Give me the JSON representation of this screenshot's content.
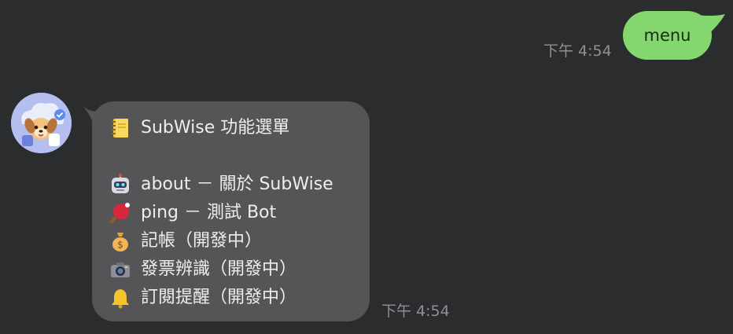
{
  "outgoing": {
    "text": "menu",
    "time": "下午 4:54"
  },
  "incoming": {
    "avatar_icon": "puppy-cloud-avatar",
    "time": "下午 4:54",
    "title": "SubWise 功能選單",
    "lines": [
      {
        "icon": "notebook-icon",
        "text": "SubWise 功能選單"
      },
      {
        "icon": "robot-icon",
        "text": "about － 關於 SubWise"
      },
      {
        "icon": "ping-pong-icon",
        "text": "ping － 測試 Bot"
      },
      {
        "icon": "money-bag-icon",
        "text": "記帳（開發中）"
      },
      {
        "icon": "camera-icon",
        "text": "發票辨識（開發中）"
      },
      {
        "icon": "bell-icon",
        "text": "訂閱提醒（開發中）"
      }
    ]
  },
  "colors": {
    "background": "#2b2c2e",
    "outgoing_bubble": "#84d66e",
    "incoming_bubble": "#555557",
    "timestamp": "#8e9094"
  }
}
